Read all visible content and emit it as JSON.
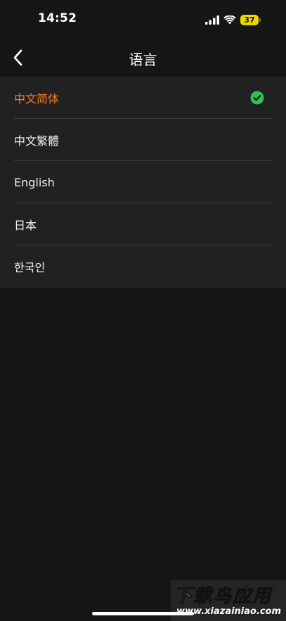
{
  "status_bar": {
    "time": "14:52",
    "battery_level": "37",
    "icons": [
      "cellular-signal-icon",
      "wifi-icon",
      "battery-icon"
    ]
  },
  "nav": {
    "title": "语言",
    "back_icon": "chevron-left-icon"
  },
  "languages": [
    {
      "label": "中文简体",
      "selected": true
    },
    {
      "label": "中文繁體",
      "selected": false
    },
    {
      "label": "English",
      "selected": false
    },
    {
      "label": "日本",
      "selected": false
    },
    {
      "label": "한국인",
      "selected": false
    }
  ],
  "selected_check_icon": "check-circle-icon",
  "colors": {
    "background": "#161616",
    "list_background": "#212121",
    "selected_text": "#ff7a1a",
    "check_green": "#2fc44f",
    "battery": "#f0d600"
  },
  "watermark": {
    "title": "下载鸟应用",
    "url": "www.xiazainiao.com"
  }
}
